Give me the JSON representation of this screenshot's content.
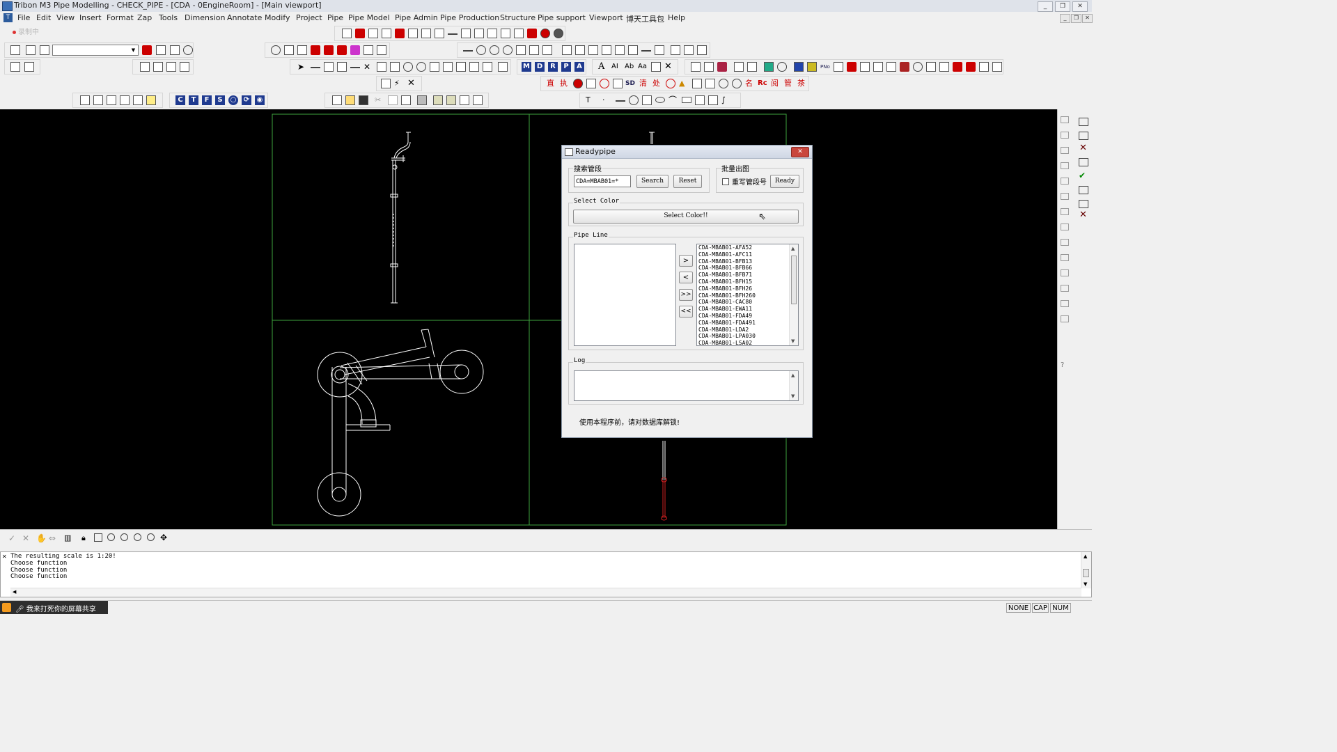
{
  "window": {
    "title": "Tribon M3 Pipe Modelling - CHECK_PIPE - [CDA - 0EngineRoom] - [Main viewport]",
    "minimize": "_",
    "restore": "❐",
    "close": "✕"
  },
  "menu": {
    "items": [
      "File",
      "Edit",
      "View",
      "Insert",
      "Format",
      "Zap",
      "Tools",
      "Dimension",
      "Annotate",
      "Modify",
      "Project",
      "Pipe",
      "Pipe Model",
      "Pipe Admin",
      "Pipe Production",
      "Structure",
      "Pipe support",
      "Viewport",
      "博天工具包",
      "Help"
    ]
  },
  "status_indicator": "录制中",
  "toolbar_letters": [
    "M",
    "D",
    "R",
    "P",
    "A"
  ],
  "toolbar_letters2": [
    "C",
    "T",
    "F",
    "S"
  ],
  "toolbar_text_sd": "SD",
  "toolbar_text_re": "Rc",
  "dialog": {
    "title": "Readypipe",
    "search_group": {
      "label": "搜索管段",
      "input_value": "CDA=MBAB01=*",
      "search_button": "Search",
      "reset_button": "Reset"
    },
    "batch_group": {
      "label": "批量出图",
      "checkbox_label": "重写管段号",
      "ready_button": "Ready"
    },
    "color_group": {
      "label": "Select Color",
      "button": "Select Color!!"
    },
    "pipeline_group": {
      "label": "Pipe Line",
      "move_right": ">",
      "move_left": "<",
      "move_all_right": ">>",
      "move_all_left": "<<",
      "available": [
        "CDA-MBAB01-AFA52",
        "CDA-MBAB01-AFC11",
        "CDA-MBAB01-BFB13",
        "CDA-MBAB01-BFB66",
        "CDA-MBAB01-BFB71",
        "CDA-MBAB01-BFH15",
        "CDA-MBAB01-BFH26",
        "CDA-MBAB01-BFH260",
        "CDA-MBAB01-CAC80",
        "CDA-MBAB01-EWA11",
        "CDA-MBAB01-FDA49",
        "CDA-MBAB01-FDA491",
        "CDA-MBAB01-LDA2",
        "CDA-MBAB01-LPA030",
        "CDA-MBAB01-LSA02"
      ]
    },
    "log_group": {
      "label": "Log"
    },
    "footer_note": "使用本程序前，请对数据库解锁!"
  },
  "command_output": [
    "The resulting scale is 1:20!",
    "Choose function",
    "Choose function",
    "Choose function"
  ],
  "share_badge": "我来打死你的屏幕共享",
  "status_boxes": [
    "NONE",
    "CAP",
    "NUM"
  ],
  "colors": {
    "viewport_border": "#3ea33e",
    "drawing_line": "#ffffff",
    "highlight_pipe": "#d02020",
    "background": "#000000"
  }
}
